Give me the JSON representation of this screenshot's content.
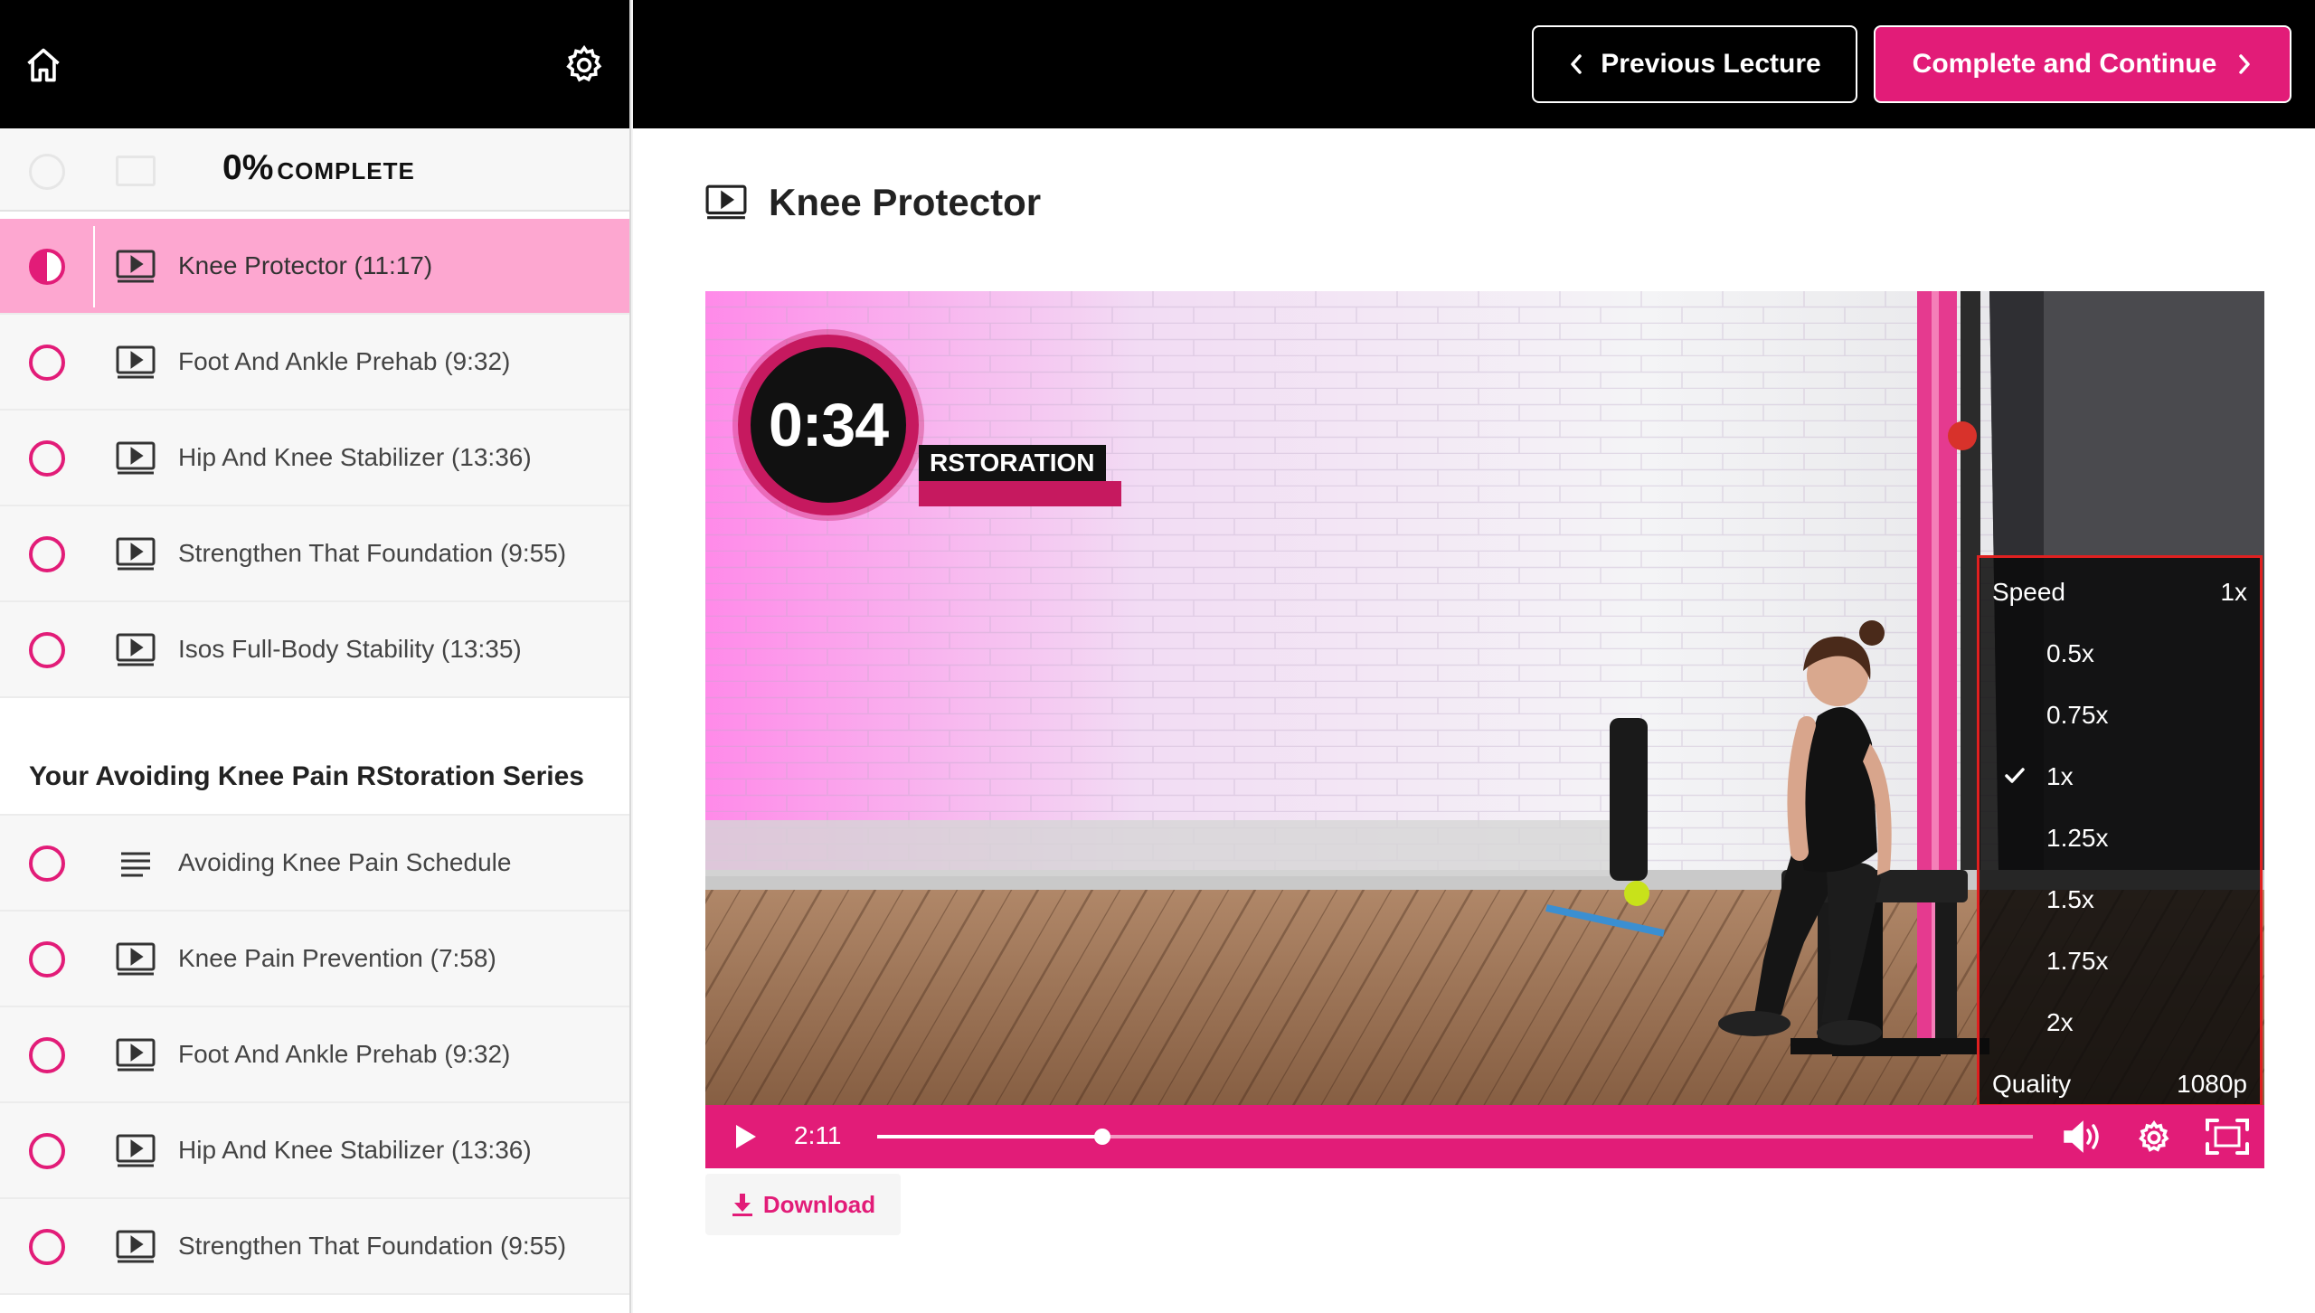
{
  "sidebar": {
    "home_icon": "home-icon",
    "settings_icon": "gear-icon",
    "progress": {
      "percent": "0%",
      "label": "COMPLETE"
    },
    "items_top": [
      {
        "label": "Knee Protector (11:17)",
        "type": "video",
        "status": "in-progress",
        "active": true
      },
      {
        "label": "Foot And Ankle Prehab (9:32)",
        "type": "video",
        "status": "incomplete"
      },
      {
        "label": "Hip And Knee Stabilizer (13:36)",
        "type": "video",
        "status": "incomplete"
      },
      {
        "label": "Strengthen That Foundation (9:55)",
        "type": "video",
        "status": "incomplete"
      },
      {
        "label": "Isos Full-Body Stability (13:35)",
        "type": "video",
        "status": "incomplete"
      }
    ],
    "section_title": "Your Avoiding Knee Pain RStoration Series",
    "items_section": [
      {
        "label": "Avoiding Knee Pain Schedule",
        "type": "text",
        "status": "incomplete"
      },
      {
        "label": "Knee Pain Prevention (7:58)",
        "type": "video",
        "status": "incomplete"
      },
      {
        "label": "Foot And Ankle Prehab (9:32)",
        "type": "video",
        "status": "incomplete"
      },
      {
        "label": "Hip And Knee Stabilizer (13:36)",
        "type": "video",
        "status": "incomplete"
      },
      {
        "label": "Strengthen That Foundation (9:55)",
        "type": "video",
        "status": "incomplete"
      }
    ]
  },
  "header": {
    "previous_label": "Previous Lecture",
    "next_label": "Complete and Continue"
  },
  "lecture": {
    "title": "Knee Protector",
    "download_label": "Download"
  },
  "player": {
    "overlay_timer": "0:34",
    "overlay_brand": "RSTORATION",
    "current_time": "2:11",
    "progress_fraction": 0.195,
    "menu": {
      "speed_label": "Speed",
      "speed_value": "1x",
      "options": [
        "0.5x",
        "0.75x",
        "1x",
        "1.25x",
        "1.5x",
        "1.75x",
        "2x"
      ],
      "selected": "1x",
      "quality_label": "Quality",
      "quality_value": "1080p"
    }
  },
  "colors": {
    "accent": "#e21c78",
    "active_row": "#fda7d0",
    "menu_outline": "#e02020"
  }
}
